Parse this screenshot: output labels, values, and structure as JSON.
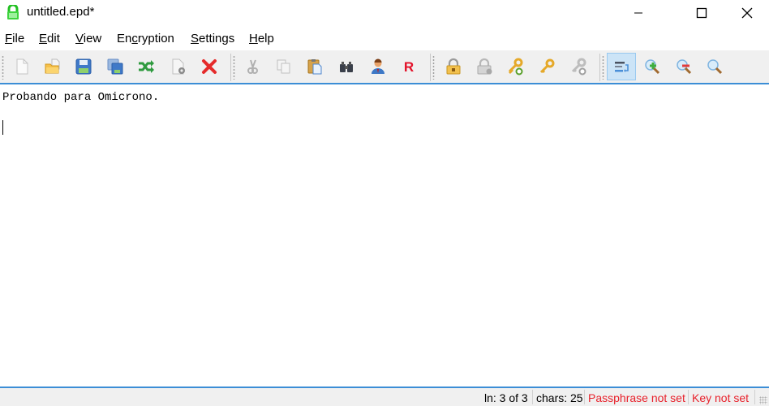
{
  "window": {
    "title": "untitled.epd*",
    "app_icon": "green-lock-icon",
    "controls": [
      "minimize",
      "maximize",
      "close"
    ]
  },
  "menu": {
    "items": [
      {
        "label": "File",
        "mnemonic": "F",
        "rest": "ile"
      },
      {
        "label": "Edit",
        "mnemonic": "E",
        "rest": "dit"
      },
      {
        "label": "View",
        "mnemonic": "V",
        "rest": "iew"
      },
      {
        "label": "Encryption",
        "pre": "En",
        "mnemonic": "c",
        "rest": "ryption"
      },
      {
        "label": "Settings",
        "mnemonic": "S",
        "rest": "ettings"
      },
      {
        "label": "Help",
        "mnemonic": "H",
        "rest": "elp"
      }
    ]
  },
  "toolbar": {
    "groups": [
      [
        {
          "icon": "new-document-icon",
          "name": "new"
        },
        {
          "icon": "open-folder-icon",
          "name": "open"
        },
        {
          "icon": "save-icon",
          "name": "save"
        },
        {
          "icon": "save-as-icon",
          "name": "save-as"
        },
        {
          "icon": "shuffle-icon",
          "name": "shuffle"
        },
        {
          "icon": "document-settings-icon",
          "name": "document-settings"
        },
        {
          "icon": "close-red-x-icon",
          "name": "close-document"
        }
      ],
      [
        {
          "icon": "cut-icon",
          "name": "cut",
          "disabled": true
        },
        {
          "icon": "copy-icon",
          "name": "copy",
          "disabled": true
        },
        {
          "icon": "paste-icon",
          "name": "paste"
        },
        {
          "icon": "binoculars-icon",
          "name": "find"
        },
        {
          "icon": "user-icon",
          "name": "user"
        },
        {
          "icon": "replace-r-icon",
          "name": "replace",
          "glyph": "R"
        }
      ],
      [
        {
          "icon": "lock-icon",
          "name": "lock"
        },
        {
          "icon": "unlock-gray-icon",
          "name": "unlock",
          "disabled": true
        },
        {
          "icon": "key-add-icon",
          "name": "add-key"
        },
        {
          "icon": "key-icon",
          "name": "key"
        },
        {
          "icon": "key-remove-gray-icon",
          "name": "remove-key",
          "disabled": true
        }
      ],
      [
        {
          "icon": "word-wrap-icon",
          "name": "word-wrap",
          "active": true
        },
        {
          "icon": "zoom-in-icon",
          "name": "zoom-in"
        },
        {
          "icon": "zoom-out-icon",
          "name": "zoom-out"
        },
        {
          "icon": "zoom-reset-icon",
          "name": "zoom-reset"
        }
      ]
    ]
  },
  "editor": {
    "lines": [
      "Probando para Omicrono.",
      "",
      ""
    ]
  },
  "statusbar": {
    "line": "ln: 3 of 3",
    "chars": "chars: 25",
    "passphrase": "Passphrase not set",
    "key": "Key not set",
    "warn_color": "#e8202a"
  }
}
